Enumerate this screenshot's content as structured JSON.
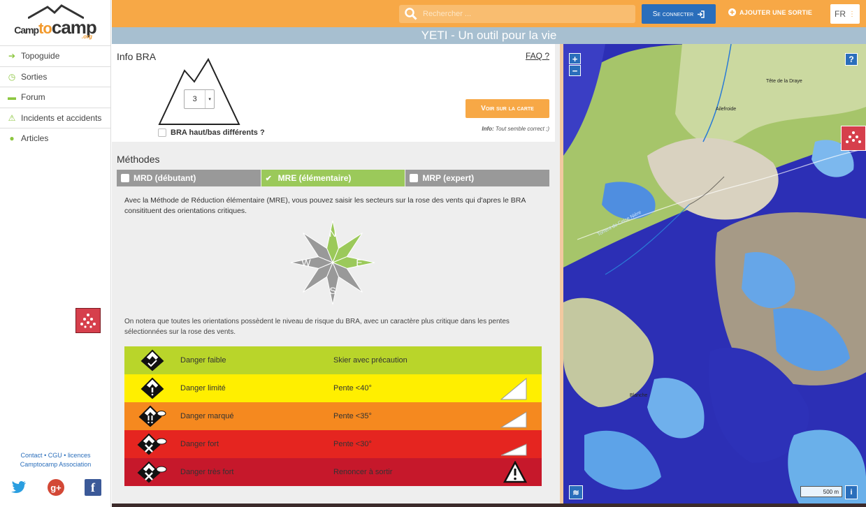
{
  "brand": {
    "logo_text_a": "Camp",
    "logo_text_b": "to",
    "logo_text_c": "camp",
    "logo_suffix": ".org"
  },
  "nav": [
    {
      "label": "Topoguide",
      "icon": "arrow-right-icon"
    },
    {
      "label": "Sorties",
      "icon": "clock-icon"
    },
    {
      "label": "Forum",
      "icon": "chat-icon"
    },
    {
      "label": "Incidents et accidents",
      "icon": "warning-icon"
    },
    {
      "label": "Articles",
      "icon": "info-icon"
    }
  ],
  "footer": {
    "contact": "Contact",
    "cgu": "CGU",
    "licences": "licences",
    "association": "Camptocamp Association",
    "sep": "•"
  },
  "topbar": {
    "search_placeholder": "Rechercher ...",
    "login_label": "Se connecter",
    "add_outing_label": "Ajouter une sortie",
    "lang": "FR"
  },
  "title": "YETI - Un outil pour la vie",
  "info_bra": {
    "heading": "Info BRA",
    "faq": "FAQ ?",
    "level": "3",
    "bra_diff_label": "BRA haut/bas différents ?",
    "voir_button": "Voir sur la carte",
    "info_label": "Info:",
    "info_value": "Tout semble correct ;)"
  },
  "methodes": {
    "heading": "Méthodes",
    "tabs": [
      {
        "label": "MRD (débutant)",
        "active": false
      },
      {
        "label": "MRE (élémentaire)",
        "active": true
      },
      {
        "label": "MRP (expert)",
        "active": false
      }
    ],
    "description": "Avec la Méthode de Réduction élémentaire (MRE), vous pouvez saisir les secteurs sur la rose des vents qui d'apres le BRA consitituent des orientations critiques.",
    "rose": {
      "n": "N",
      "e": "E",
      "s": "S",
      "w": "W",
      "selected_color": "#9bc95a",
      "unselected_color": "#999999"
    },
    "note": "On notera que toutes les orientations possèdent le niveau de risque du BRA, avec un caractère plus critique dans les pentes sélectionnées sur la rose des vents."
  },
  "danger_levels": [
    {
      "name": "Danger faible",
      "advice": "Skier avec précaution",
      "color": "#b9d52a",
      "icon": "danger-level-1-icon"
    },
    {
      "name": "Danger limité",
      "advice": "Pente <40°",
      "color": "#ffef00",
      "icon": "danger-level-2-icon"
    },
    {
      "name": "Danger marqué",
      "advice": "Pente <35°",
      "color": "#f5891f",
      "icon": "danger-level-3-icon"
    },
    {
      "name": "Danger fort",
      "advice": "Pente <30°",
      "color": "#e52520",
      "icon": "danger-level-4-icon"
    },
    {
      "name": "Danger très fort",
      "advice": "Renoncer à sortir",
      "color": "#c6182b",
      "icon": "danger-level-5-icon"
    }
  ],
  "map": {
    "zoom_in": "+",
    "zoom_out": "−",
    "help": "?",
    "scale": "500 m",
    "info": "i",
    "places": [
      "Ailefroide",
      "Tête de la Draye",
      "Torrent de Celse Nière",
      "Blanche"
    ]
  }
}
